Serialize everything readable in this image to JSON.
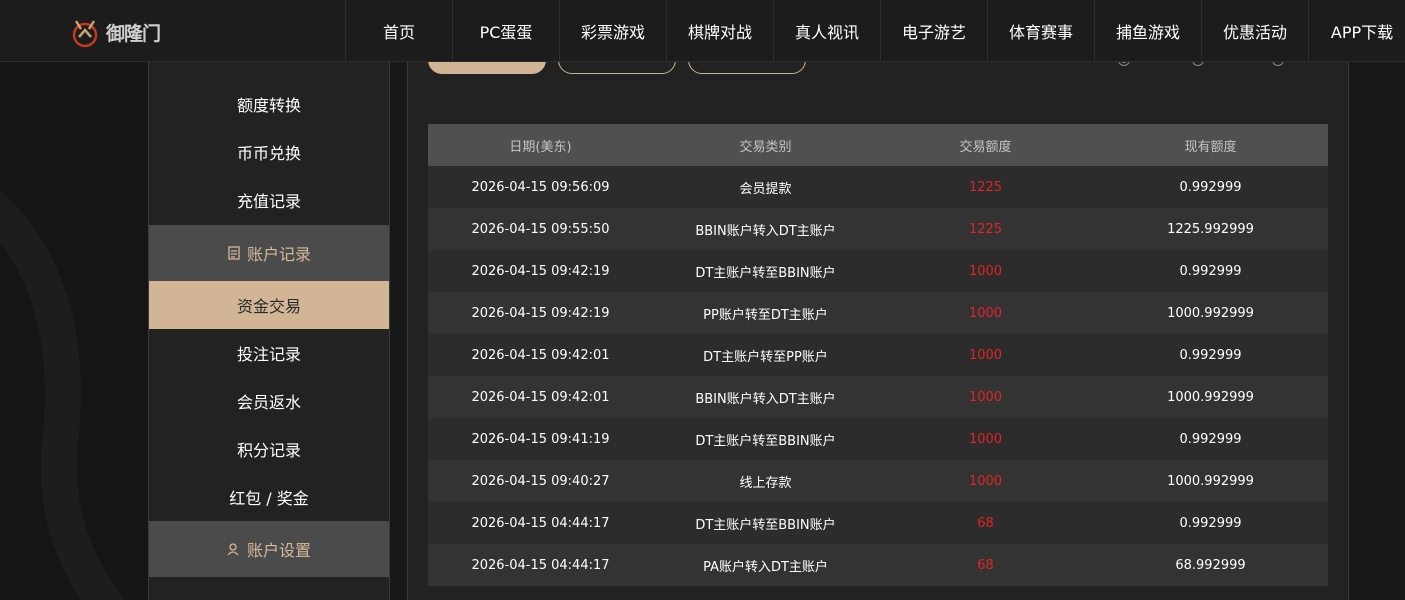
{
  "logo": {
    "text": "御隆门"
  },
  "nav": {
    "items": [
      "首页",
      "PC蛋蛋",
      "彩票游戏",
      "棋牌对战",
      "真人视讯",
      "电子游艺",
      "体育赛事",
      "捕鱼游戏",
      "优惠活动",
      "APP下载"
    ]
  },
  "sidebar": {
    "items_top": [
      "额度转换",
      "币币兑换",
      "充值记录"
    ],
    "section_records": "账户记录",
    "items_records": [
      "资金交易",
      "投注记录",
      "会员返水",
      "积分记录",
      "红包 / 奖金"
    ],
    "section_settings": "账户设置"
  },
  "table": {
    "headers": [
      "日期(美东)",
      "交易类别",
      "交易额度",
      "现有额度"
    ],
    "rows": [
      [
        "2026-04-15 09:56:09",
        "会员提款",
        "1225",
        "0.992999"
      ],
      [
        "2026-04-15 09:55:50",
        "BBIN账户转入DT主账户",
        "1225",
        "1225.992999"
      ],
      [
        "2026-04-15 09:42:19",
        "DT主账户转至BBIN账户",
        "1000",
        "0.992999"
      ],
      [
        "2026-04-15 09:42:19",
        "PP账户转至DT主账户",
        "1000",
        "1000.992999"
      ],
      [
        "2026-04-15 09:42:01",
        "DT主账户转至PP账户",
        "1000",
        "0.992999"
      ],
      [
        "2026-04-15 09:42:01",
        "BBIN账户转入DT主账户",
        "1000",
        "1000.992999"
      ],
      [
        "2026-04-15 09:41:19",
        "DT主账户转至BBIN账户",
        "1000",
        "0.992999"
      ],
      [
        "2026-04-15 09:40:27",
        "线上存款",
        "1000",
        "1000.992999"
      ],
      [
        "2026-04-15 04:44:17",
        "DT主账户转至BBIN账户",
        "68",
        "0.992999"
      ],
      [
        "2026-04-15 04:44:17",
        "PA账户转入DT主账户",
        "68",
        "68.992999"
      ]
    ]
  },
  "colors": {
    "accent": "#d2b595",
    "amount": "#e02424",
    "header_bg": "#505050"
  }
}
